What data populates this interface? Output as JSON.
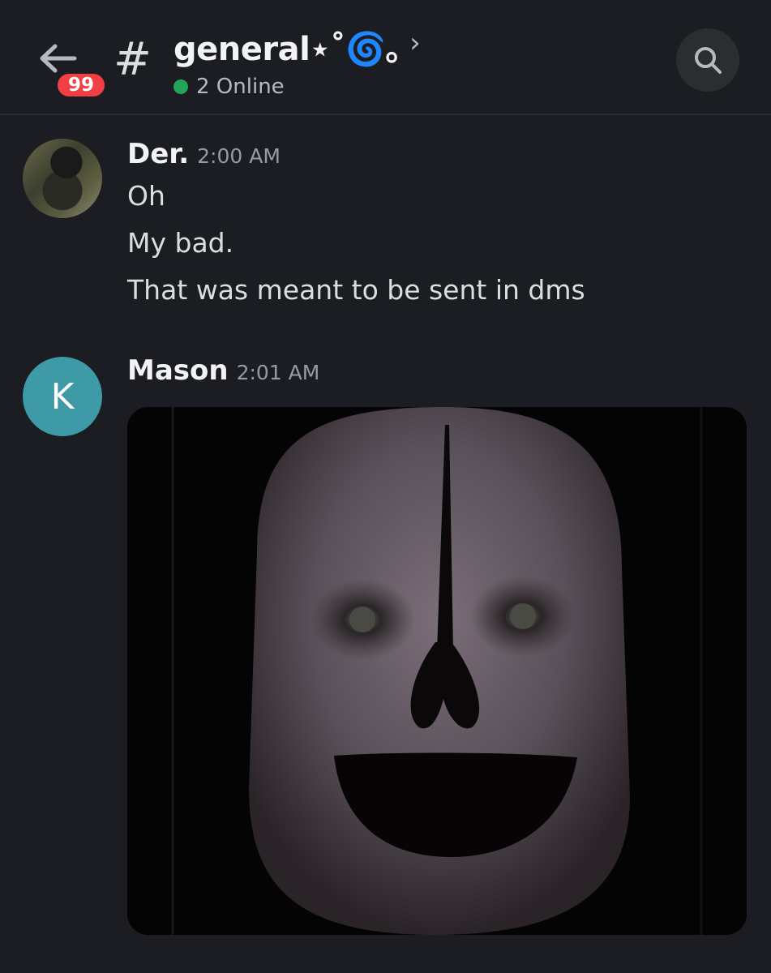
{
  "header": {
    "back_icon": "arrow-left-icon",
    "unread_badge": "99",
    "channel_prefix": "#",
    "channel_name": "general⋆˚🌀｡",
    "chevron": "›",
    "online_text": "2 Online",
    "search_icon": "search-icon"
  },
  "messages": [
    {
      "author": "Der.",
      "time": "2:00 AM",
      "avatar": "photo",
      "lines": [
        "Oh",
        "My bad.",
        "That was meant to be sent in dms"
      ]
    },
    {
      "author": "Mason",
      "time": "2:01 AM",
      "avatar_letter": "K",
      "avatar_color": "#3d9aa6",
      "attachment": "image"
    }
  ],
  "colors": {
    "background": "#1c1d22",
    "badge": "#f23f43",
    "online": "#23a559"
  }
}
